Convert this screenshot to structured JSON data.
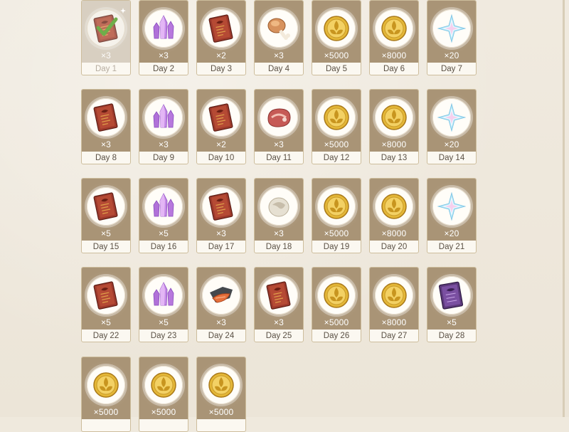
{
  "days": [
    {
      "day": "Day 1",
      "qty": "×3",
      "icon": "recipe-book-icon",
      "claimed": true
    },
    {
      "day": "Day 2",
      "qty": "×3",
      "icon": "crystal-icon",
      "claimed": false
    },
    {
      "day": "Day 3",
      "qty": "×2",
      "icon": "recipe-book-icon",
      "claimed": false
    },
    {
      "day": "Day 4",
      "qty": "×3",
      "icon": "chicken-leg-icon",
      "claimed": false
    },
    {
      "day": "Day 5",
      "qty": "×5000",
      "icon": "mora-coin-icon",
      "claimed": false
    },
    {
      "day": "Day 6",
      "qty": "×8000",
      "icon": "mora-coin-icon",
      "claimed": false
    },
    {
      "day": "Day 7",
      "qty": "×20",
      "icon": "primogem-icon",
      "claimed": false
    },
    {
      "day": "Day 8",
      "qty": "×3",
      "icon": "recipe-book-icon",
      "claimed": false
    },
    {
      "day": "Day 9",
      "qty": "×3",
      "icon": "crystal-icon",
      "claimed": false
    },
    {
      "day": "Day 10",
      "qty": "×2",
      "icon": "recipe-book-icon",
      "claimed": false
    },
    {
      "day": "Day 11",
      "qty": "×3",
      "icon": "raw-meat-icon",
      "claimed": false
    },
    {
      "day": "Day 12",
      "qty": "×5000",
      "icon": "mora-coin-icon",
      "claimed": false
    },
    {
      "day": "Day 13",
      "qty": "×8000",
      "icon": "mora-coin-icon",
      "claimed": false
    },
    {
      "day": "Day 14",
      "qty": "×20",
      "icon": "primogem-icon",
      "claimed": false
    },
    {
      "day": "Day 15",
      "qty": "×5",
      "icon": "recipe-book-icon",
      "claimed": false
    },
    {
      "day": "Day 16",
      "qty": "×5",
      "icon": "crystal-icon",
      "claimed": false
    },
    {
      "day": "Day 17",
      "qty": "×3",
      "icon": "recipe-book-icon",
      "claimed": false
    },
    {
      "day": "Day 18",
      "qty": "×3",
      "icon": "egg-icon",
      "claimed": false
    },
    {
      "day": "Day 19",
      "qty": "×5000",
      "icon": "mora-coin-icon",
      "claimed": false
    },
    {
      "day": "Day 20",
      "qty": "×8000",
      "icon": "mora-coin-icon",
      "claimed": false
    },
    {
      "day": "Day 21",
      "qty": "×20",
      "icon": "primogem-icon",
      "claimed": false
    },
    {
      "day": "Day 22",
      "qty": "×5",
      "icon": "recipe-book-icon",
      "claimed": false
    },
    {
      "day": "Day 23",
      "qty": "×5",
      "icon": "crystal-icon",
      "claimed": false
    },
    {
      "day": "Day 24",
      "qty": "×3",
      "icon": "fish-icon",
      "claimed": false
    },
    {
      "day": "Day 25",
      "qty": "×3",
      "icon": "recipe-book-icon",
      "claimed": false
    },
    {
      "day": "Day 26",
      "qty": "×5000",
      "icon": "mora-coin-icon",
      "claimed": false
    },
    {
      "day": "Day 27",
      "qty": "×8000",
      "icon": "mora-coin-icon",
      "claimed": false
    },
    {
      "day": "Day 28",
      "qty": "×5",
      "icon": "purple-book-icon",
      "claimed": false
    },
    {
      "day": "",
      "qty": "×5000",
      "icon": "mora-coin-icon",
      "claimed": false
    },
    {
      "day": "",
      "qty": "×5000",
      "icon": "mora-coin-icon",
      "claimed": false
    },
    {
      "day": "",
      "qty": "×5000",
      "icon": "mora-coin-icon",
      "claimed": false
    }
  ]
}
